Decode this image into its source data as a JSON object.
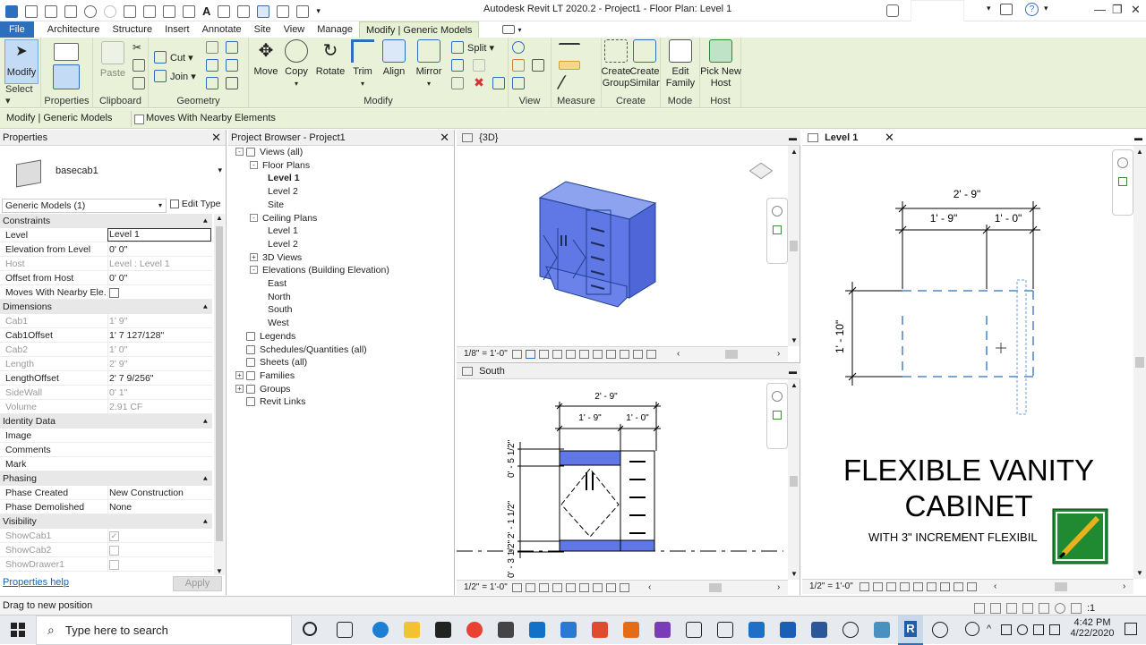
{
  "app": {
    "title": "Autodesk Revit LT 2020.2 - Project1 - Floor Plan: Level 1"
  },
  "tabs": [
    "File",
    "Architecture",
    "Structure",
    "Insert",
    "Annotate",
    "Site",
    "View",
    "Manage",
    "Modify | Generic Models"
  ],
  "ribbon": {
    "modify_label": "Modify",
    "select_label": "Select",
    "properties_label": "Properties",
    "paste_label": "Paste",
    "clipboard_label": "Clipboard",
    "cut_label": "Cut",
    "join_label": "Join",
    "geometry_label": "Geometry",
    "move_label": "Move",
    "copy_label": "Copy",
    "rotate_label": "Rotate",
    "trim_label": "Trim",
    "align_label": "Align",
    "mirror_label": "Mirror",
    "split_label": "Split",
    "modify_group_label": "Modify",
    "view_label": "View",
    "measure_label": "Measure",
    "create_group_label": "Create Group",
    "create_similar_label": "Create Similar",
    "create_label": "Create",
    "edit_family_label": "Edit Family",
    "mode_label": "Mode",
    "pick_new_host_label": "Pick New Host",
    "host_label": "Host"
  },
  "options_bar": {
    "context": "Modify | Generic Models",
    "moves_with_nearby": "Moves With Nearby Elements"
  },
  "properties": {
    "title": "Properties",
    "family_name": "basecab1",
    "selector": "Generic Models (1)",
    "edit_type": "Edit Type",
    "sections": [
      {
        "name": "Constraints",
        "rows": [
          {
            "k": "Level",
            "v": "Level 1",
            "dim": false,
            "edit": true
          },
          {
            "k": "Elevation from Level",
            "v": "0'  0\"",
            "dim": false
          },
          {
            "k": "Host",
            "v": "Level : Level 1",
            "dim": true
          },
          {
            "k": "Offset from Host",
            "v": "0'  0\"",
            "dim": false
          },
          {
            "k": "Moves With Nearby Ele...",
            "v": "",
            "dim": false,
            "check": true
          }
        ]
      },
      {
        "name": "Dimensions",
        "rows": [
          {
            "k": "Cab1",
            "v": "1'  9\"",
            "dim": true
          },
          {
            "k": "Cab1Offset",
            "v": "1'  7 127/128\"",
            "dim": false
          },
          {
            "k": "Cab2",
            "v": "1'  0\"",
            "dim": true
          },
          {
            "k": "Length",
            "v": "2'  9\"",
            "dim": true
          },
          {
            "k": "LengthOffset",
            "v": "2'  7 9/256\"",
            "dim": false
          },
          {
            "k": "SideWall",
            "v": "0'  1\"",
            "dim": true
          },
          {
            "k": "Volume",
            "v": "2.91 CF",
            "dim": true
          }
        ]
      },
      {
        "name": "Identity Data",
        "rows": [
          {
            "k": "Image",
            "v": "",
            "dim": false
          },
          {
            "k": "Comments",
            "v": "",
            "dim": false
          },
          {
            "k": "Mark",
            "v": "",
            "dim": false
          }
        ]
      },
      {
        "name": "Phasing",
        "rows": [
          {
            "k": "Phase Created",
            "v": "New Construction",
            "dim": false
          },
          {
            "k": "Phase Demolished",
            "v": "None",
            "dim": false
          }
        ]
      },
      {
        "name": "Visibility",
        "rows": [
          {
            "k": "ShowCab1",
            "v": "",
            "dim": true,
            "check": true,
            "checked": true
          },
          {
            "k": "ShowCab2",
            "v": "",
            "dim": true,
            "check": true
          },
          {
            "k": "ShowDrawer1",
            "v": "",
            "dim": true,
            "check": true
          }
        ]
      }
    ],
    "help": "Properties help",
    "apply": "Apply"
  },
  "browser": {
    "title": "Project Browser - Project1",
    "nodes": [
      {
        "label": "Views (all)",
        "level": 0,
        "toggle": "-",
        "icon": true
      },
      {
        "label": "Floor Plans",
        "level": 1,
        "toggle": "-"
      },
      {
        "label": "Level 1",
        "level": 2,
        "bold": true
      },
      {
        "label": "Level 2",
        "level": 2
      },
      {
        "label": "Site",
        "level": 2
      },
      {
        "label": "Ceiling Plans",
        "level": 1,
        "toggle": "-"
      },
      {
        "label": "Level 1",
        "level": 2
      },
      {
        "label": "Level 2",
        "level": 2
      },
      {
        "label": "3D Views",
        "level": 1,
        "toggle": "+"
      },
      {
        "label": "Elevations (Building Elevation)",
        "level": 1,
        "toggle": "-"
      },
      {
        "label": "East",
        "level": 2
      },
      {
        "label": "North",
        "level": 2
      },
      {
        "label": "South",
        "level": 2
      },
      {
        "label": "West",
        "level": 2
      },
      {
        "label": "Legends",
        "level": 0,
        "icon": true
      },
      {
        "label": "Schedules/Quantities (all)",
        "level": 0,
        "icon": true
      },
      {
        "label": "Sheets (all)",
        "level": 0,
        "icon": true
      },
      {
        "label": "Families",
        "level": 0,
        "toggle": "+",
        "icon": true
      },
      {
        "label": "Groups",
        "level": 0,
        "toggle": "+",
        "icon": true
      },
      {
        "label": "Revit Links",
        "level": 0,
        "icon": true
      }
    ]
  },
  "view3d": {
    "title": "{3D}",
    "scale": "1/8\" = 1'-0\""
  },
  "viewSouth": {
    "title": "South",
    "scale": "1/2\" = 1'-0\"",
    "dim_total": "2' - 9\"",
    "dim_a": "1' - 9\"",
    "dim_b": "1' - 0\"",
    "dim_v1": "0' - 5 1/2\"",
    "dim_v2": "2' - 1 1/2\"",
    "dim_v3": "0' - 3 1/2\""
  },
  "viewPlan": {
    "title": "Level 1",
    "scale": "1/2\" = 1'-0\"",
    "dim_total": "2' - 9\"",
    "dim_a": "1' - 9\"",
    "dim_b": "1' - 0\"",
    "dim_v": "1' - 10\"",
    "heading1": "FLEXIBLE VANITY",
    "heading2": "CABINET",
    "subheading": "WITH 3\" INCREMENT FLEXIBIL"
  },
  "status": {
    "text": "Drag to new position",
    "filter_count": ":1"
  },
  "taskbar": {
    "search": "Type here to search",
    "time": "4:42 PM",
    "date": "4/22/2020"
  }
}
